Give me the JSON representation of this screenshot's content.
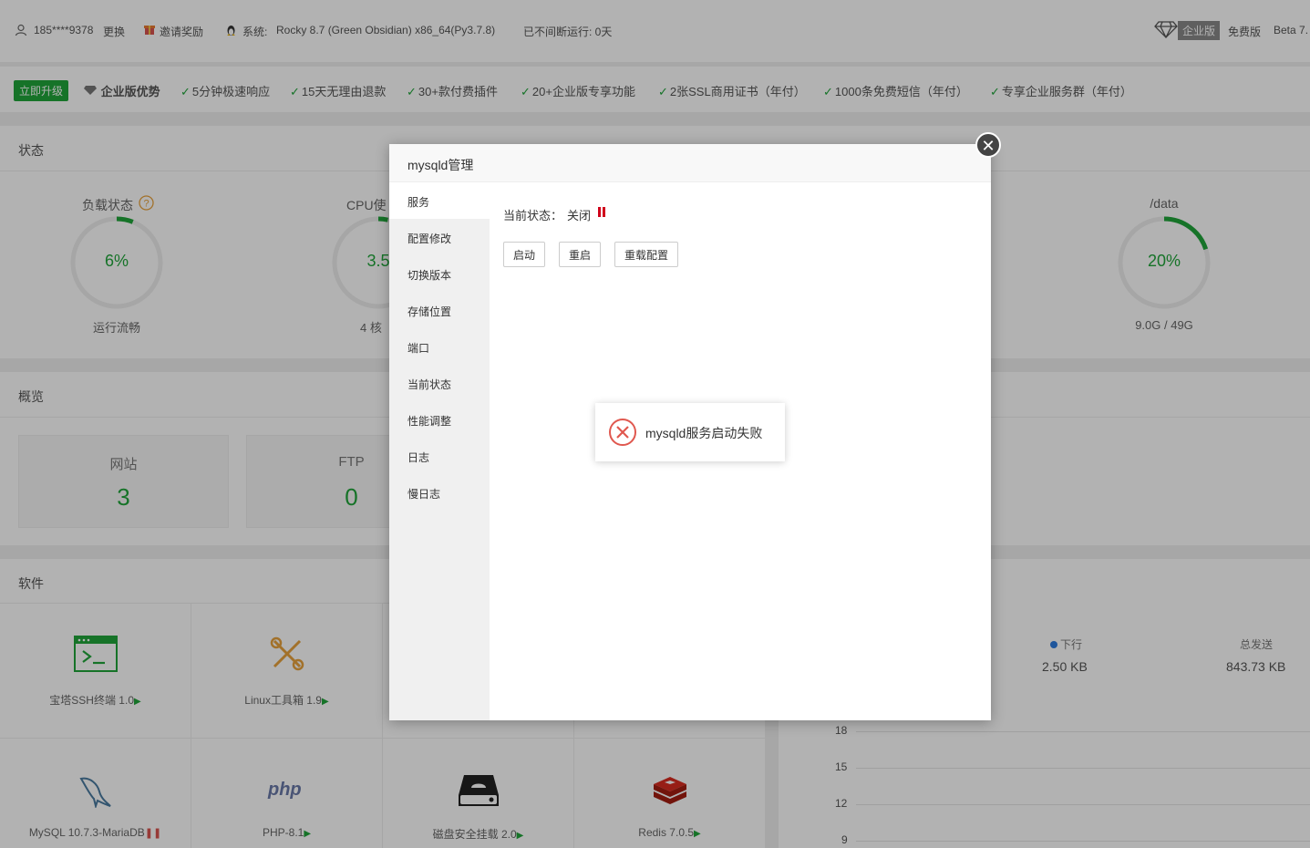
{
  "topbar": {
    "phone": "185****9378",
    "change": "更换",
    "invite": "邀请奖励",
    "system_label": "系统:",
    "system_value": "Rocky 8.7 (Green Obsidian) x86_64(Py3.7.8)",
    "uptime": "已不间断运行: 0天",
    "enterprise": "企业版",
    "free": "免费版",
    "beta": "Beta 7."
  },
  "promo": {
    "upgrade": "立即升级",
    "advantage": "企业版优势",
    "features": [
      "5分钟极速响应",
      "15天无理由退款",
      "30+款付费插件",
      "20+企业版专享功能",
      "2张SSL商用证书（年付）",
      "1000条免费短信（年付）",
      "专享企业服务群（年付）"
    ]
  },
  "status": {
    "title": "状态",
    "load": {
      "label": "负载状态",
      "value": "6%",
      "percent": 6,
      "sub": "运行流畅"
    },
    "cpu": {
      "label": "CPU使",
      "value": "3.5",
      "percent": 3.5,
      "sub": "4 核"
    },
    "disk": {
      "label": "/data",
      "value": "20%",
      "percent": 20,
      "sub": "9.0G / 49G"
    }
  },
  "overview": {
    "title": "概览",
    "site": {
      "label": "网站",
      "value": "3"
    },
    "ftp": {
      "label": "FTP",
      "value": "0"
    }
  },
  "software": {
    "title": "软件",
    "items": [
      {
        "name": "宝塔SSH终端 1.0"
      },
      {
        "name": "Linux工具箱 1.9"
      },
      {
        "name": "MySQL 10.7.3-MariaDB"
      },
      {
        "name": "PHP-8.1"
      },
      {
        "name": "磁盘安全挂载 2.0"
      },
      {
        "name": "Redis 7.0.5"
      }
    ]
  },
  "traffic": {
    "down_label": "下行",
    "down_value": "2.50 KB",
    "sent_label": "总发送",
    "sent_value": "843.73 KB",
    "yticks": [
      "18",
      "15",
      "12",
      "9"
    ]
  },
  "modal": {
    "title": "mysqld管理",
    "menu": [
      "服务",
      "配置修改",
      "切换版本",
      "存储位置",
      "端口",
      "当前状态",
      "性能调整",
      "日志",
      "慢日志"
    ],
    "status_label": "当前状态：",
    "status_value": "关闭",
    "buttons": [
      "启动",
      "重启",
      "重载配置"
    ]
  },
  "toast": {
    "message": "mysqld服务启动失败"
  },
  "colors": {
    "accent": "#20a53a",
    "danger": "#d9534f"
  }
}
